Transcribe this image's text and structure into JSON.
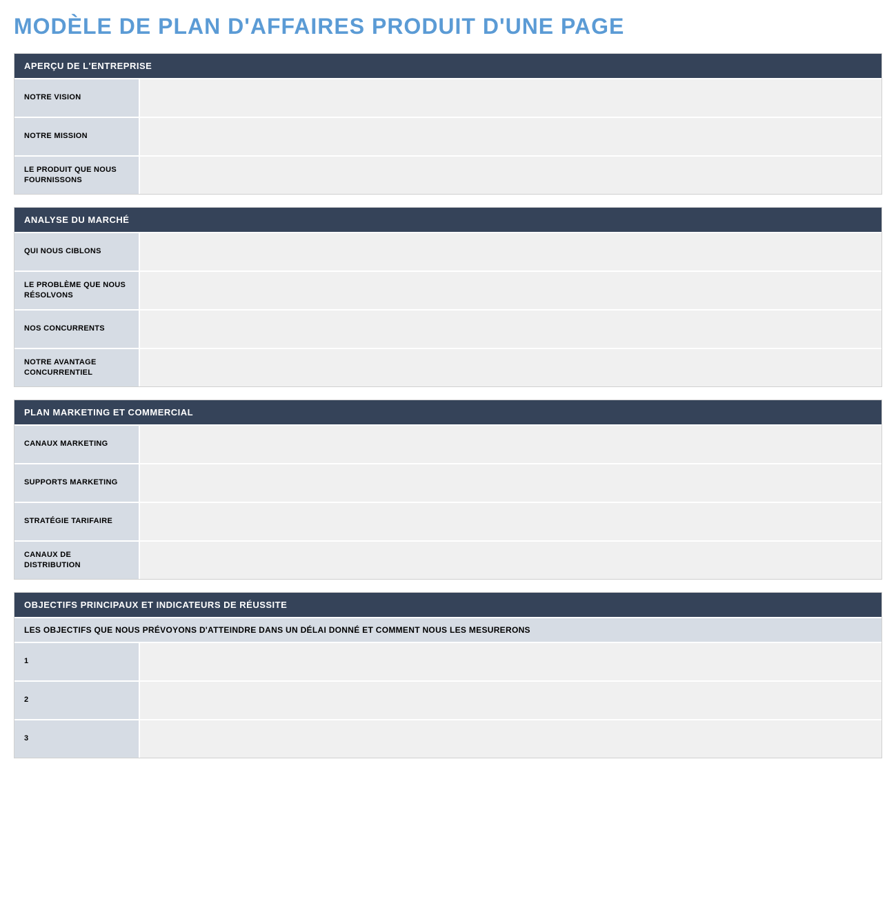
{
  "title": "MODÈLE DE PLAN D'AFFAIRES PRODUIT D'UNE PAGE",
  "sections": {
    "overview": {
      "header": "APERÇU DE L'ENTREPRISE",
      "rows": {
        "vision": {
          "label": "NOTRE VISION",
          "value": ""
        },
        "mission": {
          "label": "NOTRE MISSION",
          "value": ""
        },
        "product": {
          "label": "LE PRODUIT QUE NOUS FOURNISSONS",
          "value": ""
        }
      }
    },
    "market": {
      "header": "ANALYSE DU MARCHÉ",
      "rows": {
        "target": {
          "label": "QUI NOUS CIBLONS",
          "value": ""
        },
        "problem": {
          "label": "LE PROBLÈME QUE NOUS RÉSOLVONS",
          "value": ""
        },
        "competitors": {
          "label": "NOS CONCURRENTS",
          "value": ""
        },
        "advantage": {
          "label": "NOTRE AVANTAGE CONCURRENTIEL",
          "value": ""
        }
      }
    },
    "marketing": {
      "header": "PLAN MARKETING ET COMMERCIAL",
      "rows": {
        "channels": {
          "label": "CANAUX MARKETING",
          "value": ""
        },
        "supports": {
          "label": "SUPPORTS MARKETING",
          "value": ""
        },
        "pricing": {
          "label": "STRATÉGIE TARIFAIRE",
          "value": ""
        },
        "distribution": {
          "label": "CANAUX DE DISTRIBUTION",
          "value": ""
        }
      }
    },
    "objectives": {
      "header": "OBJECTIFS PRINCIPAUX ET INDICATEURS DE RÉUSSITE",
      "subheader": "LES OBJECTIFS QUE NOUS PRÉVOYONS D'ATTEINDRE DANS UN DÉLAI DONNÉ ET COMMENT NOUS LES MESURERONS",
      "rows": {
        "obj1": {
          "label": "1",
          "value": ""
        },
        "obj2": {
          "label": "2",
          "value": ""
        },
        "obj3": {
          "label": "3",
          "value": ""
        }
      }
    }
  }
}
